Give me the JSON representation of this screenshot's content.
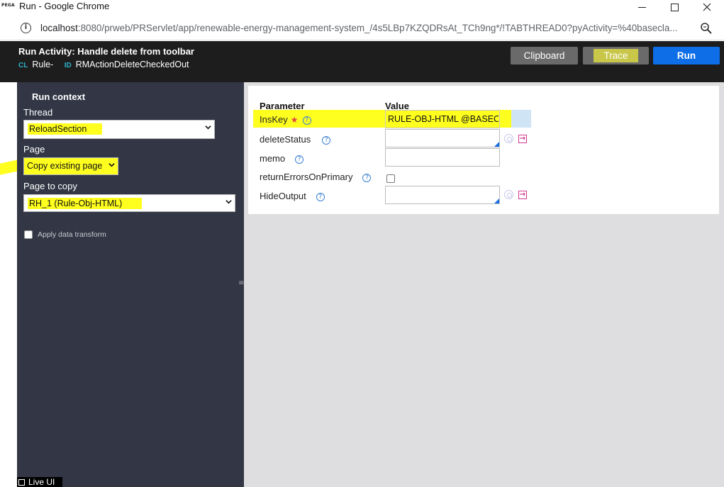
{
  "window": {
    "logo": "PEGA",
    "title": "Run - Google Chrome"
  },
  "address": {
    "host": "localhost",
    "path": ":8080/prweb/PRServlet/app/renewable-energy-management-system_/4s5LBp7KZQDRsAt_TCh9ng*/!TABTHREAD0?pyActivity=%40basecla..."
  },
  "header": {
    "title": "Run  Activity:  Handle delete from toolbar",
    "class_tag": "CL",
    "class_value": "Rule-",
    "id_tag": "ID",
    "id_value": "RMActionDeleteCheckedOut",
    "clipboard_label": "Clipboard",
    "trace_label": "Trace",
    "run_label": "Run"
  },
  "run_context": {
    "heading": "Run context",
    "thread_label": "Thread",
    "thread_value": "ReloadSection",
    "page_label": "Page",
    "page_value": "Copy existing page",
    "page_to_copy_label": "Page to copy",
    "page_to_copy_value": "RH_1 (Rule-Obj-HTML)",
    "apply_label": "Apply data transform",
    "live_ui": "Live UI"
  },
  "params": {
    "col_param": "Parameter",
    "col_value": "Value",
    "rows": [
      {
        "name": "InsKey",
        "value": "RULE-OBJ-HTML @BASECLA",
        "required": true
      },
      {
        "name": "deleteStatus",
        "value": ""
      },
      {
        "name": "memo",
        "value": ""
      },
      {
        "name": "returnErrorsOnPrimary",
        "value": ""
      },
      {
        "name": "HideOutput",
        "value": ""
      }
    ]
  },
  "colors": {
    "highlight": "#ffff1f",
    "run_button": "#0d6ee8",
    "left_panel": "#323645",
    "header": "#1d1d1d"
  }
}
